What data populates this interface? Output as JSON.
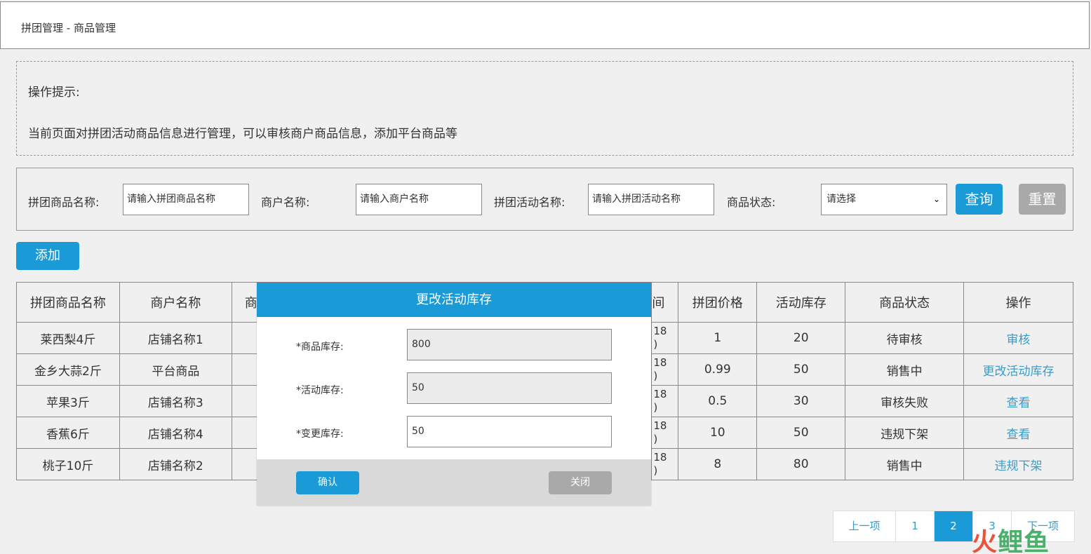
{
  "breadcrumb": "拼团管理 - 商品管理",
  "tips": {
    "title": "操作提示:",
    "desc": "当前页面对拼团活动商品信息进行管理，可以审核商户商品信息，添加平台商品等"
  },
  "search": {
    "goods_label": "拼团商品名称:",
    "goods_placeholder": "请输入拼团商品名称",
    "merchant_label": "商户名称:",
    "merchant_placeholder": "请输入商户名称",
    "activity_label": "拼团活动名称:",
    "activity_placeholder": "请输入拼团活动名称",
    "status_label": "商品状态:",
    "status_value": "请选择",
    "query_label": "查询",
    "reset_label": "重置"
  },
  "add_label": "添加",
  "table": {
    "headers": [
      "拼团商品名称",
      "商户名称",
      "商",
      "",
      "间",
      "拼团价格",
      "活动库存",
      "商品状态",
      "操作"
    ],
    "rows": [
      {
        "name": "莱西梨4斤",
        "merchant": "店铺名称1",
        "time": "18\n)",
        "price": "1",
        "stock": "20",
        "status": "待审核",
        "op": "审核"
      },
      {
        "name": "金乡大蒜2斤",
        "merchant": "平台商品",
        "time": "18\n)",
        "price": "0.99",
        "stock": "50",
        "status": "销售中",
        "op": "更改活动库存"
      },
      {
        "name": "苹果3斤",
        "merchant": "店铺名称3",
        "time": "18\n)",
        "price": "0.5",
        "stock": "30",
        "status": "审核失败",
        "op": "查看"
      },
      {
        "name": "香蕉6斤",
        "merchant": "店铺名称4",
        "time": "18\n)",
        "price": "10",
        "stock": "50",
        "status": "违规下架",
        "op": "查看"
      },
      {
        "name": "桃子10斤",
        "merchant": "店铺名称2",
        "time": "18\n)",
        "price": "8",
        "stock": "80",
        "status": "销售中",
        "op": "违规下架"
      }
    ]
  },
  "modal": {
    "title": "更改活动库存",
    "goods_stock_label": "*商品库存:",
    "goods_stock_value": "800",
    "activity_stock_label": "*活动库存:",
    "activity_stock_value": "50",
    "change_stock_label": "*变更库存:",
    "change_stock_value": "50",
    "confirm_label": "确认",
    "close_label": "关闭"
  },
  "pager": {
    "prev": "上一项",
    "pages": [
      "1",
      "2",
      "3"
    ],
    "active": "2",
    "next": "下一项"
  },
  "watermark": "火鲤鱼"
}
